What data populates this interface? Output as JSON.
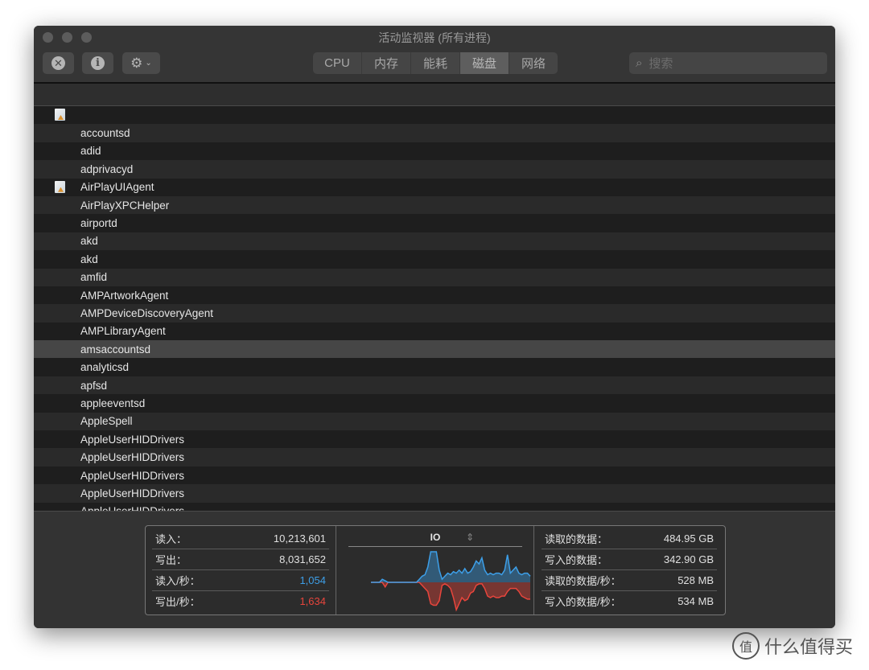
{
  "window": {
    "title": "活动监视器 (所有进程)"
  },
  "toolbar": {
    "tabs": [
      {
        "label": "CPU"
      },
      {
        "label": "内存"
      },
      {
        "label": "能耗"
      },
      {
        "label": "磁盘",
        "active": true
      },
      {
        "label": "网络"
      }
    ],
    "search_placeholder": "搜索"
  },
  "processes": [
    "",
    "accountsd",
    "adid",
    "adprivacyd",
    "AirPlayUIAgent",
    "AirPlayXPCHelper",
    "airportd",
    "akd",
    "akd",
    "amfid",
    "AMPArtworkAgent",
    "AMPDeviceDiscoveryAgent",
    "AMPLibraryAgent",
    "amsaccountsd",
    "analyticsd",
    "apfsd",
    "appleeventsd",
    "AppleSpell",
    "AppleUserHIDDrivers",
    "AppleUserHIDDrivers",
    "AppleUserHIDDrivers",
    "AppleUserHIDDrivers",
    "AppleUserHIDDrivers"
  ],
  "selected_process": "amsaccountsd",
  "stats_left": [
    {
      "label": "读入：",
      "value": "10,213,601"
    },
    {
      "label": "写出：",
      "value": "8,031,652"
    },
    {
      "label": "读入/秒：",
      "value": "1,054",
      "color": "#3d9fe8"
    },
    {
      "label": "写出/秒：",
      "value": "1,634",
      "color": "#e8453c"
    }
  ],
  "graph": {
    "label": "IO",
    "read_color": "#3d9fe8",
    "write_color": "#e8453c",
    "read": [
      0,
      0,
      0,
      0,
      0.1,
      0.05,
      0,
      0,
      0,
      0,
      0,
      0,
      0,
      0,
      0,
      0,
      0,
      0.1,
      0.2,
      0.25,
      0.5,
      1,
      1,
      1,
      0.4,
      0.1,
      0.2,
      0.3,
      0.25,
      0.35,
      0.3,
      0.4,
      0.3,
      0.45,
      0.3,
      0.35,
      0.5,
      0.7,
      0.6,
      0.8,
      0.4,
      0.25,
      0.3,
      0.25,
      0.3,
      0.3,
      0.25,
      0.4,
      0.9,
      0.3,
      0.4,
      0.5,
      0.3,
      0.25,
      0.3,
      0.3,
      0.2
    ],
    "write": [
      0,
      0,
      0,
      0,
      0,
      0.15,
      0,
      0,
      0,
      0,
      0,
      0,
      0,
      0,
      0,
      0,
      0,
      0,
      0.1,
      0.2,
      0.3,
      0.7,
      0.75,
      0.75,
      0.6,
      0.1,
      0.05,
      0.1,
      0.2,
      0.5,
      0.9,
      0.7,
      0.5,
      0.6,
      0.55,
      0.35,
      0.3,
      0.1,
      0.05,
      0.05,
      0.2,
      0.45,
      0.5,
      0.45,
      0.5,
      0.5,
      0.45,
      0.45,
      0.3,
      0.2,
      0.2,
      0.2,
      0.3,
      0.45,
      0.5,
      0.55,
      0.55
    ]
  },
  "stats_right": [
    {
      "label": "读取的数据：",
      "value": "484.95 GB"
    },
    {
      "label": "写入的数据：",
      "value": "342.90 GB"
    },
    {
      "label": "读取的数据/秒：",
      "value": "528 MB"
    },
    {
      "label": "写入的数据/秒：",
      "value": "534 MB"
    }
  ],
  "watermark": "什么值得买"
}
